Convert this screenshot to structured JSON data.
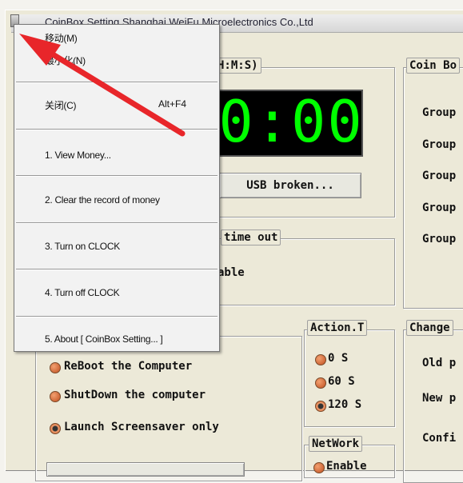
{
  "window": {
    "title": "CoinBox Setting    Shanghai WeiFu Microelectronics Co.,Ltd"
  },
  "clock": {
    "legend": "H:M:S)",
    "digits": "00:00",
    "usb_button": "USB broken..."
  },
  "timeout": {
    "legend": "time out",
    "enable_partial": "able"
  },
  "coinbox": {
    "legend": "Coin Bo",
    "groups": [
      "Group",
      "Group",
      "Group",
      "Group",
      "Group"
    ]
  },
  "action_options": [
    {
      "label": "ReBoot the Computer",
      "selected": false
    },
    {
      "label": "ShutDown the computer",
      "selected": false
    },
    {
      "label": "Launch Screensaver only",
      "selected": true
    }
  ],
  "action_time": {
    "legend": "Action.T",
    "options": [
      {
        "label": "0 S",
        "selected": false
      },
      {
        "label": "60 S",
        "selected": false
      },
      {
        "label": "120 S",
        "selected": true
      }
    ]
  },
  "network": {
    "legend": "NetWork",
    "enable_partial": "Enable"
  },
  "change_password": {
    "legend": "Change",
    "old_label": "Old p",
    "new_label": "New p",
    "confirm_label": "Confi"
  },
  "context_menu": {
    "move": "移动(M)",
    "minimize": "最小化(N)",
    "close": "关闭(C)",
    "close_shortcut": "Alt+F4",
    "item1": "1. View Money...",
    "item2": "2. Clear the record of money",
    "item3": "3. Turn on CLOCK",
    "item4": "4. Turn off CLOCK",
    "item5": "5. About [ CoinBox Setting... ]"
  },
  "colors": {
    "arrow": "#e8262a",
    "digits": "#00ff00",
    "radio": "#d86a30"
  }
}
